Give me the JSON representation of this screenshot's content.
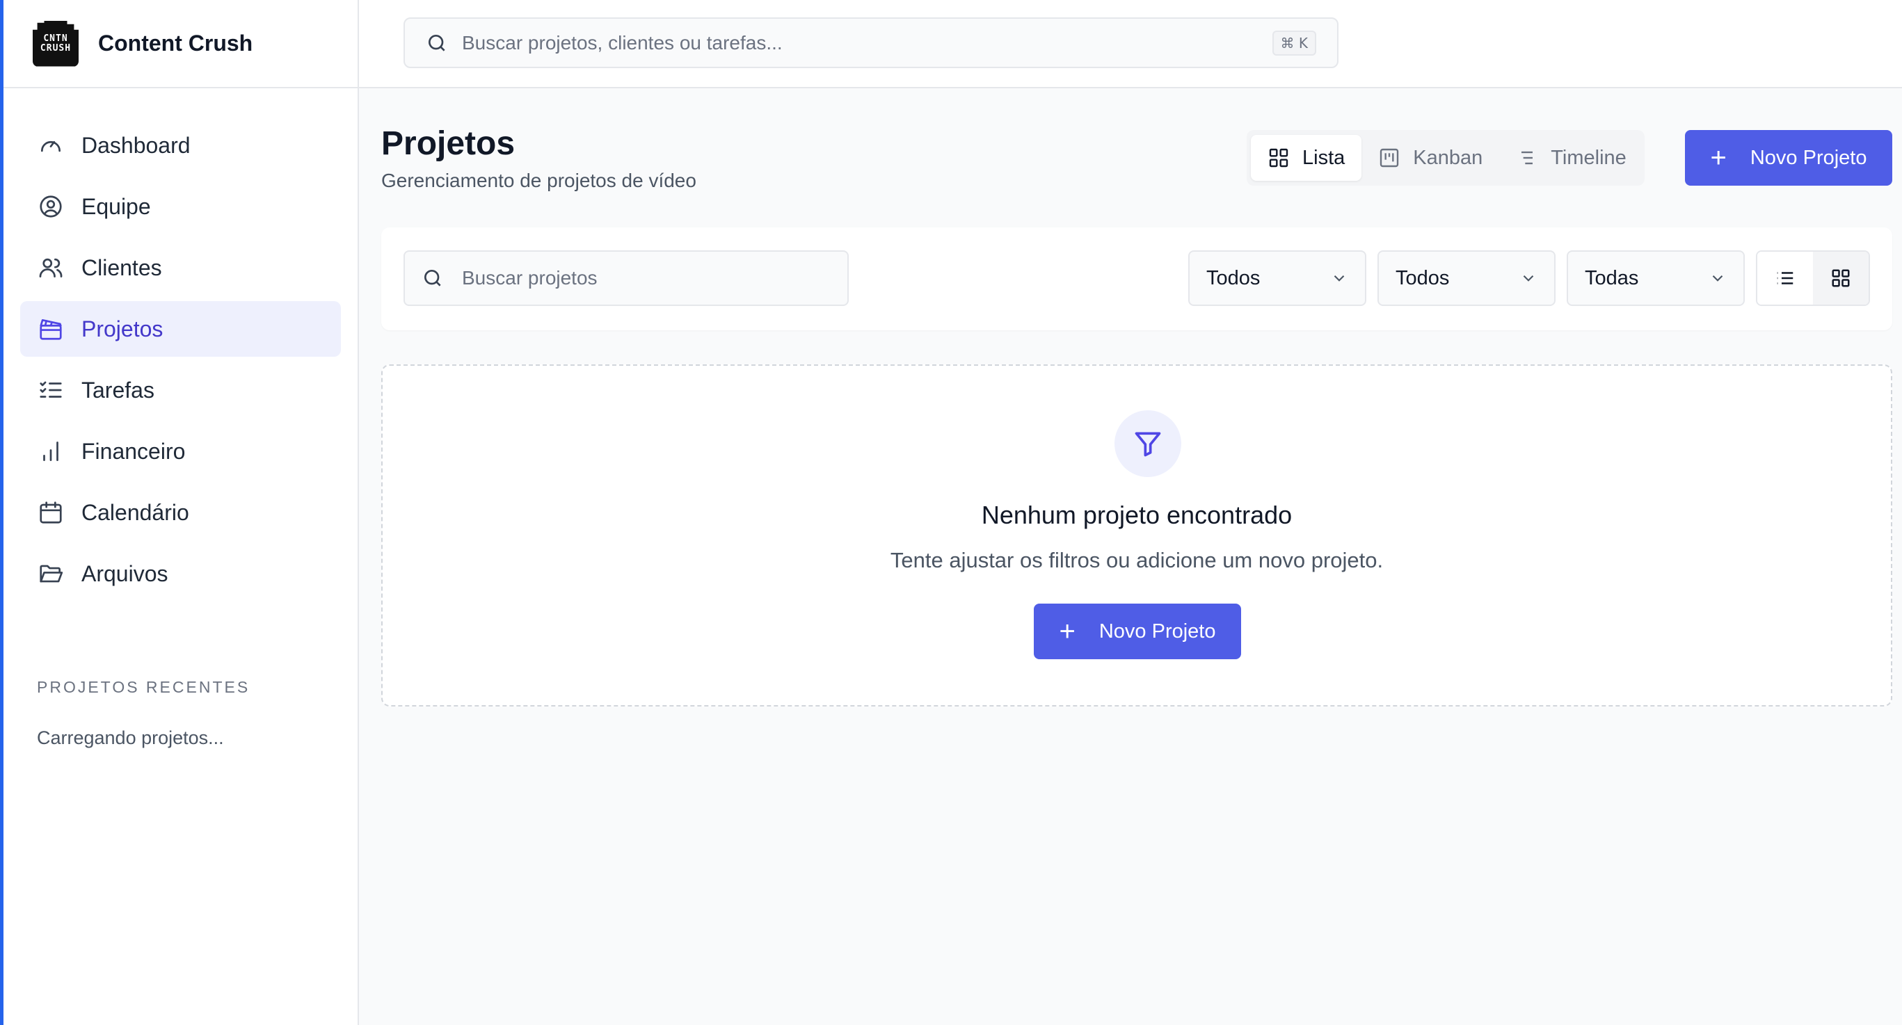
{
  "brand": {
    "name": "Content Crush",
    "logo_line1": "CNTN",
    "logo_line2": "CRUSH"
  },
  "topbar": {
    "search_placeholder": "Buscar projetos, clientes ou tarefas...",
    "shortcut": "⌘ K"
  },
  "sidebar": {
    "items": [
      {
        "label": "Dashboard",
        "icon": "gauge-icon"
      },
      {
        "label": "Equipe",
        "icon": "user-circle-icon"
      },
      {
        "label": "Clientes",
        "icon": "users-icon"
      },
      {
        "label": "Projetos",
        "icon": "clapperboard-icon",
        "active": true
      },
      {
        "label": "Tarefas",
        "icon": "list-checks-icon"
      },
      {
        "label": "Financeiro",
        "icon": "bar-chart-icon"
      },
      {
        "label": "Calendário",
        "icon": "calendar-icon"
      },
      {
        "label": "Arquivos",
        "icon": "folder-open-icon"
      }
    ],
    "recent_title": "PROJETOS RECENTES",
    "recent_loading": "Carregando projetos..."
  },
  "page": {
    "title": "Projetos",
    "subtitle": "Gerenciamento de projetos de vídeo",
    "views": [
      "Lista",
      "Kanban",
      "Timeline"
    ],
    "active_view": "Lista",
    "new_project_label": "Novo Projeto"
  },
  "filters": {
    "search_placeholder": "Buscar projetos",
    "select_1": "Todos",
    "select_2": "Todos",
    "select_3": "Todas",
    "active_layout": "grid"
  },
  "empty_state": {
    "title": "Nenhum projeto encontrado",
    "subtitle": "Tente ajustar os filtros ou adicione um novo projeto.",
    "button_label": "Novo Projeto"
  },
  "colors": {
    "accent": "#4f5de6",
    "active_bg": "#eef0fd",
    "active_text": "#4338ca"
  }
}
